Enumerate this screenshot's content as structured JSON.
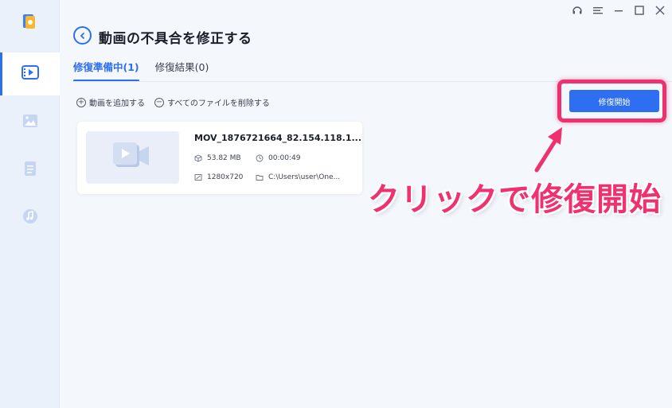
{
  "window": {
    "controls": [
      "headset-icon",
      "menu-icon",
      "minimize-icon",
      "maximize-icon",
      "close-icon"
    ]
  },
  "header": {
    "title": "動画の不具合を修正する"
  },
  "tabs": [
    {
      "label": "修復準備中(1)",
      "active": true
    },
    {
      "label": "修復結果(0)",
      "active": false
    }
  ],
  "toolbar": {
    "add_label": "動画を追加する",
    "delete_all_label": "すべてのファイルを削除する",
    "start_label": "修復開始"
  },
  "sidebar": {
    "items": [
      {
        "icon": "video-icon",
        "active": true
      },
      {
        "icon": "image-icon",
        "active": false
      },
      {
        "icon": "document-icon",
        "active": false
      },
      {
        "icon": "music-icon",
        "active": false
      }
    ]
  },
  "file": {
    "name": "MOV_1876721664_82.154.118.1...",
    "size": "53.82 MB",
    "duration": "00:00:49",
    "resolution": "1280x720",
    "path": "C:\\Users\\user\\One..."
  },
  "annotation": {
    "text": "クリックで修復開始"
  },
  "colors": {
    "accent": "#2d6ff0",
    "highlight": "#f0316f"
  }
}
